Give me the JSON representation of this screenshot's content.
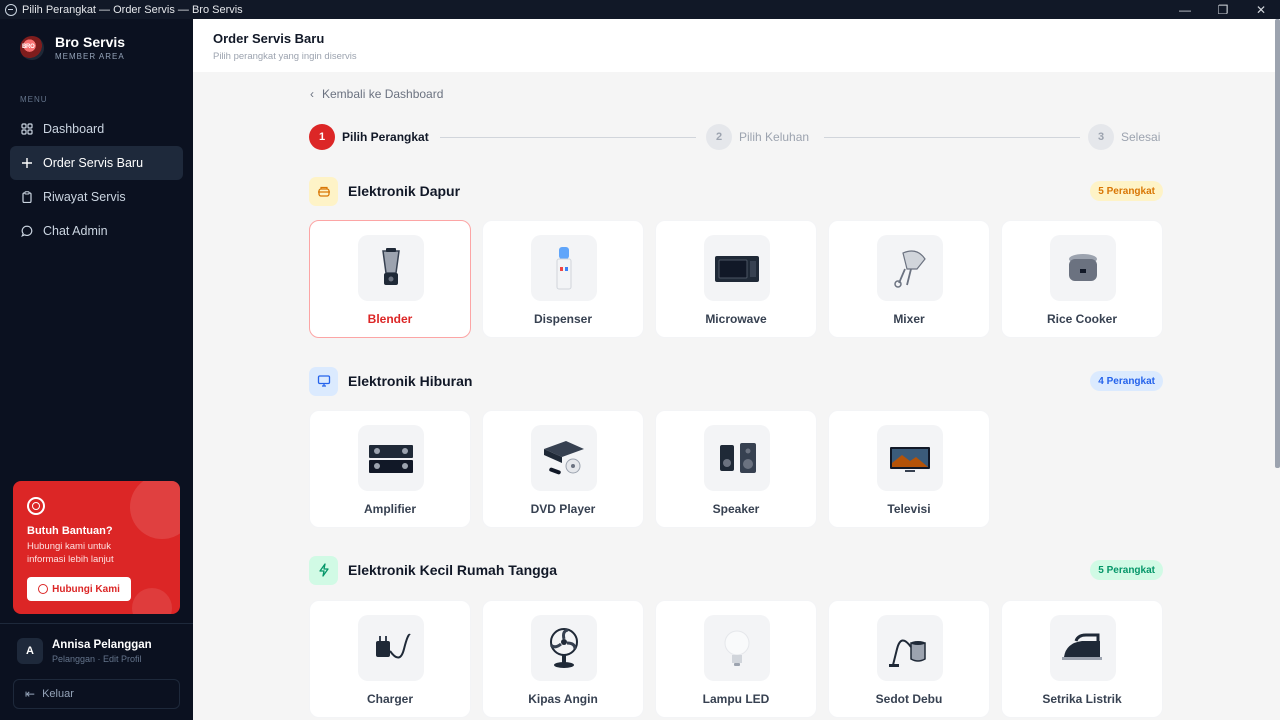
{
  "window": {
    "title": "Pilih Perangkat — Order Servis — Bro Servis",
    "minimize": "—",
    "maximize": "❐",
    "close": "✕"
  },
  "brand": {
    "name": "Bro Servis",
    "subtitle": "MEMBER AREA"
  },
  "sidebar": {
    "menu_label": "MENU",
    "items": [
      {
        "label": "Dashboard",
        "icon": "grid-icon",
        "active": false
      },
      {
        "label": "Order Servis Baru",
        "icon": "plus-icon",
        "active": true
      },
      {
        "label": "Riwayat Servis",
        "icon": "clipboard-icon",
        "active": false
      },
      {
        "label": "Chat Admin",
        "icon": "chat-icon",
        "active": false
      }
    ],
    "help": {
      "title": "Butuh Bantuan?",
      "desc": "Hubungi kami untuk informasi lebih lanjut",
      "button": "Hubungi Kami"
    },
    "user": {
      "initial": "A",
      "name": "Annisa Pelanggan",
      "role": "Pelanggan · Edit Profil"
    },
    "logout": "Keluar"
  },
  "header": {
    "title": "Order Servis Baru",
    "subtitle": "Pilih perangkat yang ingin diservis"
  },
  "back_link": "Kembali ke Dashboard",
  "steps": [
    {
      "num": "1",
      "label": "Pilih Perangkat",
      "active": true
    },
    {
      "num": "2",
      "label": "Pilih Keluhan",
      "active": false
    },
    {
      "num": "3",
      "label": "Selesai",
      "active": false
    }
  ],
  "sections": [
    {
      "title": "Elektronik Dapur",
      "badge": "5 Perangkat",
      "devices": [
        "Blender",
        "Dispenser",
        "Microwave",
        "Mixer",
        "Rice Cooker"
      ]
    },
    {
      "title": "Elektronik Hiburan",
      "badge": "4 Perangkat",
      "devices": [
        "Amplifier",
        "DVD Player",
        "Speaker",
        "Televisi"
      ]
    },
    {
      "title": "Elektronik Kecil Rumah Tangga",
      "badge": "5 Perangkat",
      "devices": [
        "Charger",
        "Kipas Angin",
        "Lampu LED",
        "Sedot Debu",
        "Setrika Listrik"
      ]
    }
  ],
  "selected_device": "Blender",
  "colors": {
    "accent": "#dc2626",
    "sidebar_bg": "#0b1120",
    "kitchen_badge": "#fef3c7",
    "entertainment_badge": "#dbeafe",
    "household_badge": "#d1fae5"
  }
}
